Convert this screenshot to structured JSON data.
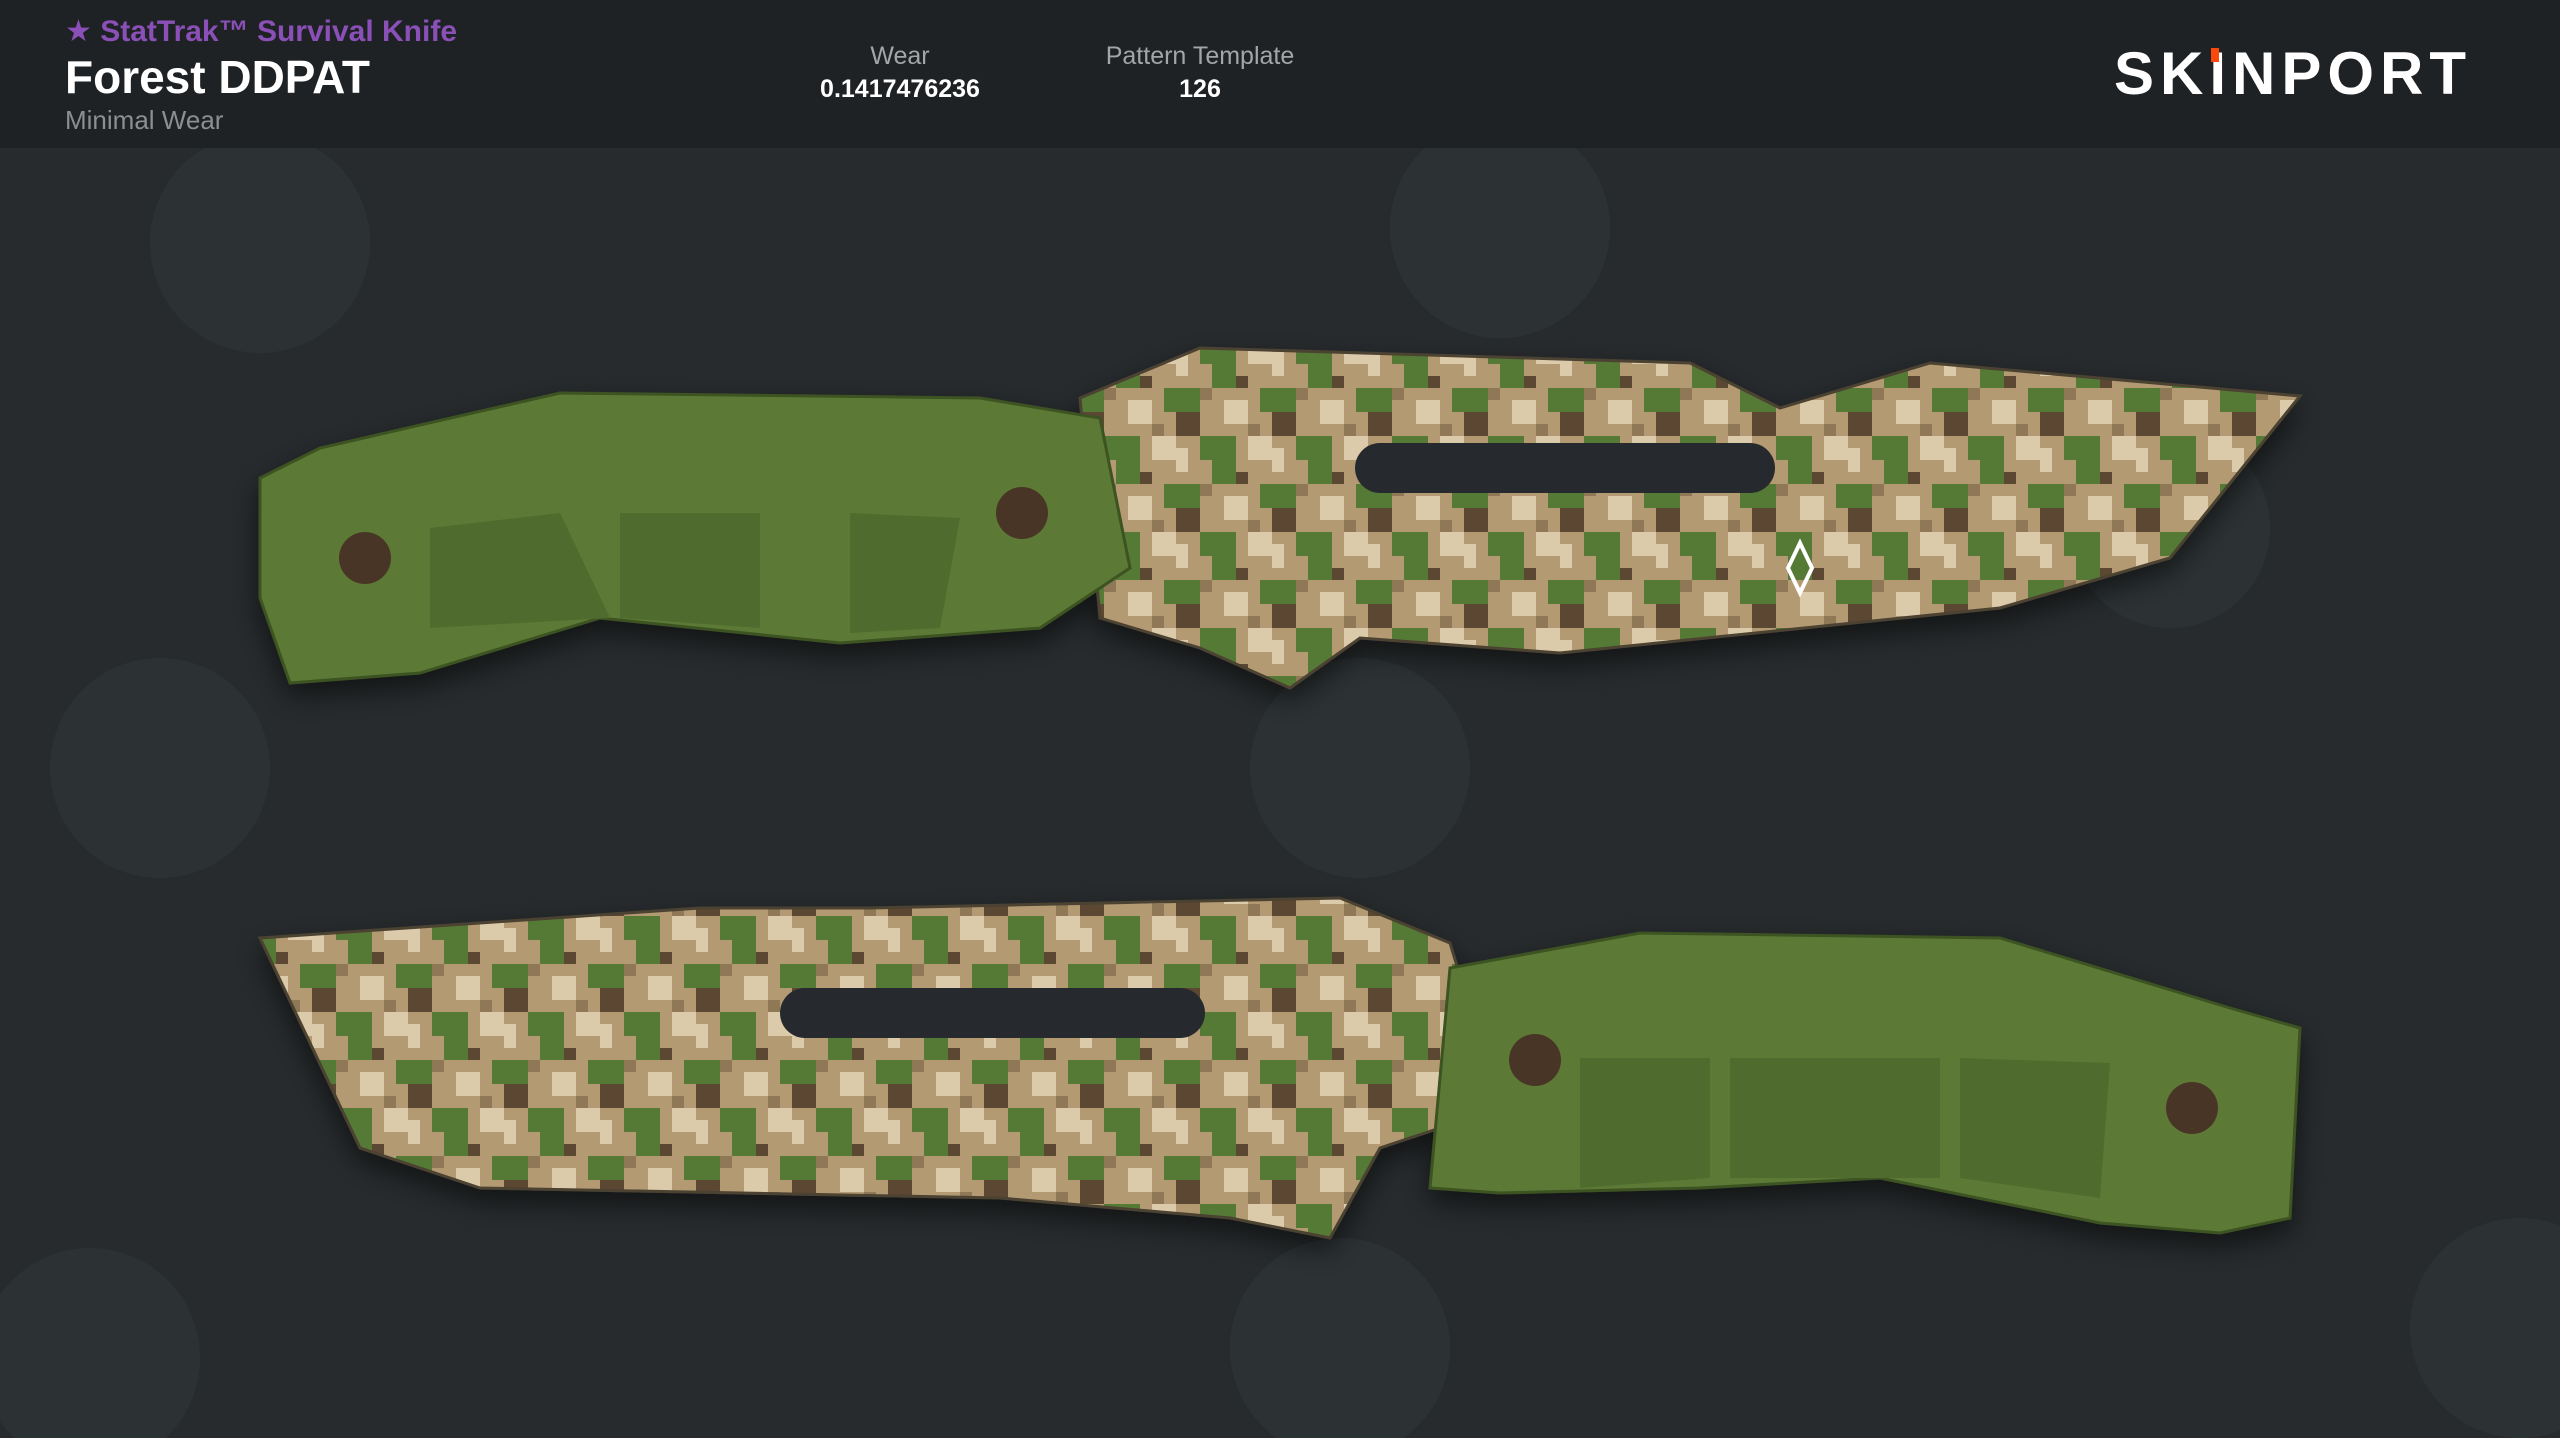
{
  "item": {
    "stattrak_label": "★ StatTrak™ Survival Knife",
    "name": "Forest DDPAT",
    "exterior": "Minimal Wear"
  },
  "stats": {
    "wear_label": "Wear",
    "wear_value": "0.1417476236",
    "pattern_label": "Pattern Template",
    "pattern_value": "126"
  },
  "brand": {
    "name": "SKINPORT",
    "accent_color": "#fa490a"
  },
  "colors": {
    "header_bg": "#1f2224",
    "page_bg": "#272b2d",
    "stattrak": "#8a50b8",
    "handle_green": "#5b7a35",
    "camo_tan": "#b39a72",
    "camo_light": "#dccbab",
    "camo_green": "#557a35",
    "camo_brown": "#5c4630"
  }
}
